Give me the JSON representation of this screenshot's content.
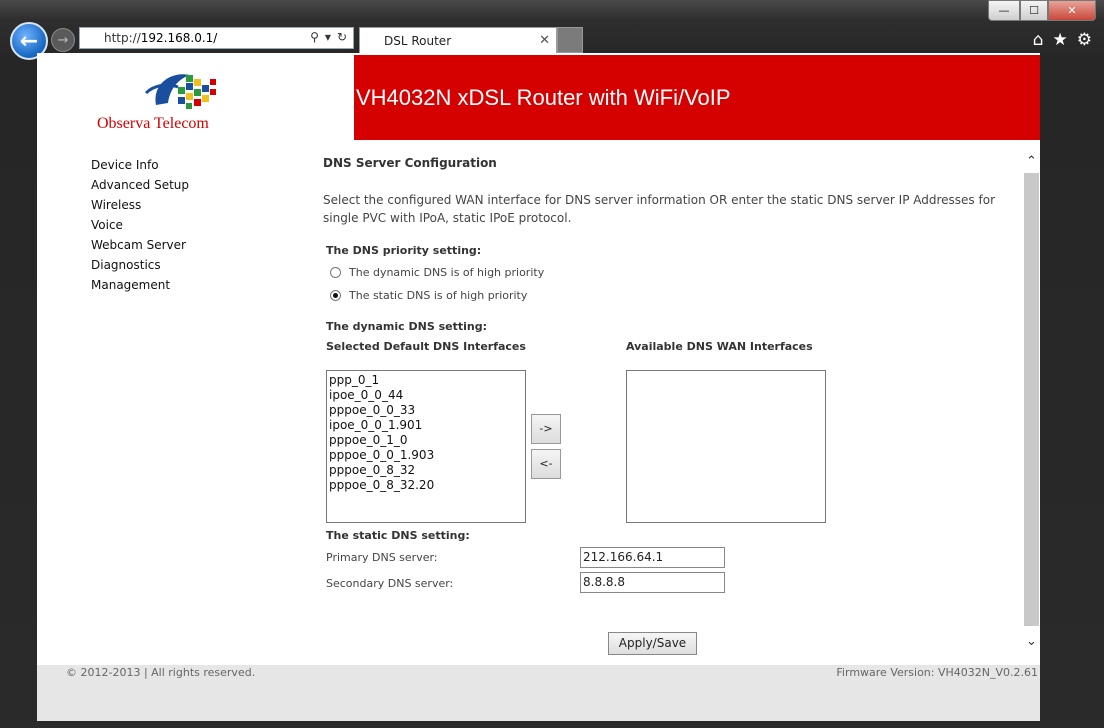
{
  "browser": {
    "url_prefix": "http://",
    "url_host": "192.168.0.1/",
    "tab_title": "DSL Router",
    "win_min": "—",
    "win_max": "☐",
    "win_close": "✕"
  },
  "header": {
    "logo_text": "Observa Telecom",
    "title": "VH4032N xDSL Router with WiFi/VoIP"
  },
  "nav": {
    "items": [
      "Device Info",
      "Advanced Setup",
      "Wireless",
      "Voice",
      "Webcam Server",
      "Diagnostics",
      "Management"
    ]
  },
  "main": {
    "title": "DNS Server Configuration",
    "description": "Select the configured WAN interface for DNS server information OR enter the static DNS server IP Addresses for single PVC with IPoA, static IPoE protocol.",
    "priority_label": "The DNS priority setting:",
    "priority_options": [
      "The dynamic DNS is of high priority",
      "The static DNS is of high priority"
    ],
    "priority_selected": "static",
    "dynamic_label": "The dynamic DNS setting:",
    "selected_label": "Selected Default DNS Interfaces",
    "available_label": "Available DNS WAN Interfaces",
    "selected_interfaces": [
      "ppp_0_1",
      "ipoe_0_0_44",
      "pppoe_0_0_33",
      "ipoe_0_0_1.901",
      "pppoe_0_1_0",
      "pppoe_0_0_1.903",
      "pppoe_0_8_32",
      "pppoe_0_8_32.20"
    ],
    "available_interfaces": [],
    "move_right": "->",
    "move_left": "<-",
    "static_label": "The static DNS setting:",
    "primary_label": "Primary DNS server:",
    "primary_value": "212.166.64.1",
    "secondary_label": "Secondary DNS server:",
    "secondary_value": "8.8.8.8",
    "apply_label": "Apply/Save"
  },
  "footer": {
    "copyright": "© 2012-2013 | All rights reserved.",
    "firmware": "Firmware Version: VH4032N_V0.2.61"
  },
  "colors": {
    "brand_red": "#d50000",
    "back_button_blue": "#1565c0"
  }
}
